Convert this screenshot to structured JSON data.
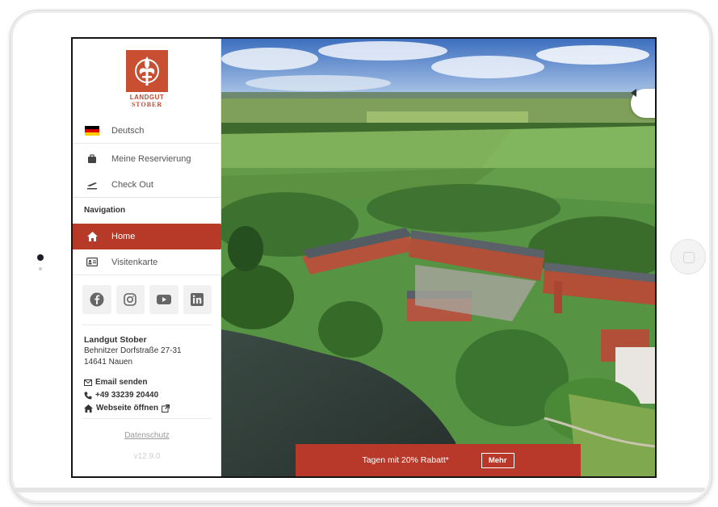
{
  "brand": {
    "line1": "LANDGUT",
    "line2": "STOBER",
    "color": "#c94f33"
  },
  "sidebar": {
    "language": {
      "label": "Deutsch",
      "icon": "german-flag-icon"
    },
    "items": [
      {
        "label": "Meine Reservierung",
        "icon": "briefcase-icon"
      },
      {
        "label": "Check Out",
        "icon": "plane-departure-icon"
      }
    ],
    "nav_heading": "Navigation",
    "nav_items": [
      {
        "label": "Home",
        "icon": "home-icon",
        "active": true
      },
      {
        "label": "Visitenkarte",
        "icon": "id-card-icon",
        "active": false
      }
    ],
    "socials": [
      "facebook-icon",
      "instagram-icon",
      "youtube-icon",
      "linkedin-icon"
    ],
    "contact": {
      "name": "Landgut Stober",
      "street": "Behnitzer Dorfstraße 27-31",
      "city": "14641 Nauen",
      "email_label": "Email senden",
      "phone": "+49 33239 20440",
      "website_label": "Webseite öffnen"
    },
    "privacy_label": "Datenschutz",
    "version": "v12.9.0"
  },
  "promo": {
    "text": "Tagen mit 20% Rabatt*",
    "button_label": "Mehr"
  },
  "colors": {
    "accent": "#b63a27",
    "promo": "#b8392a"
  }
}
